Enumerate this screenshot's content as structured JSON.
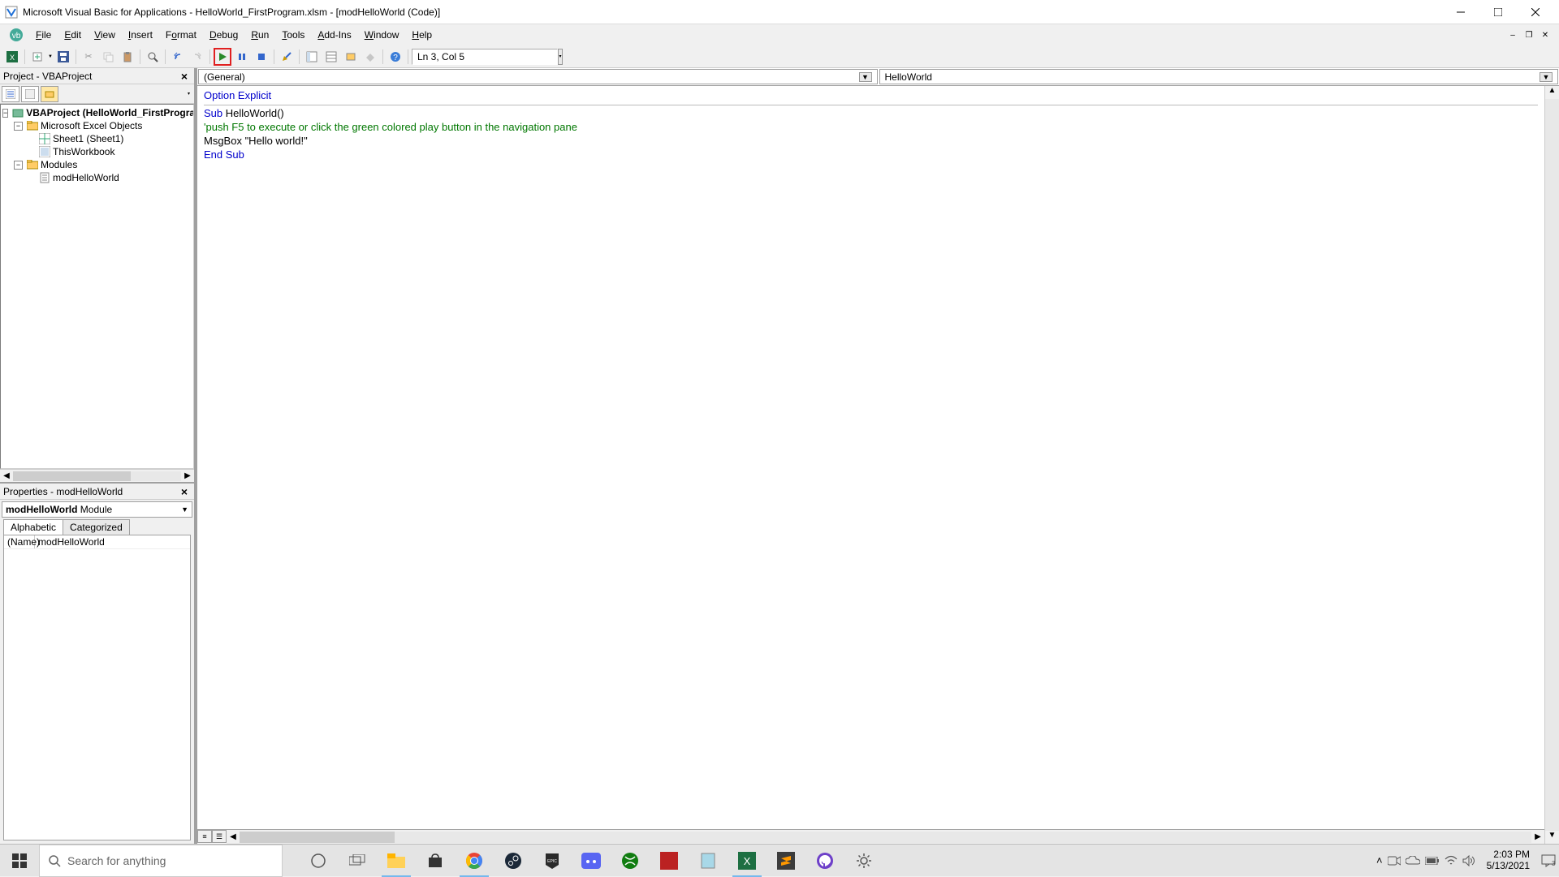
{
  "window": {
    "title": "Microsoft Visual Basic for Applications - HelloWorld_FirstProgram.xlsm - [modHelloWorld (Code)]"
  },
  "menubar": {
    "file": "File",
    "edit": "Edit",
    "view": "View",
    "insert": "Insert",
    "format": "Format",
    "debug": "Debug",
    "run": "Run",
    "tools": "Tools",
    "addins": "Add-Ins",
    "window": "Window",
    "help": "Help"
  },
  "toolbar": {
    "cursor_pos": "Ln 3, Col 5"
  },
  "project_panel": {
    "title": "Project - VBAProject",
    "root": "VBAProject (HelloWorld_FirstProgram.xlsm)",
    "excel_objects": "Microsoft Excel Objects",
    "sheet1": "Sheet1 (Sheet1)",
    "thisworkbook": "ThisWorkbook",
    "modules": "Modules",
    "mod1": "modHelloWorld"
  },
  "properties_panel": {
    "title": "Properties - modHelloWorld",
    "combo_object": "modHelloWorld",
    "combo_type": "Module",
    "tab_alpha": "Alphabetic",
    "tab_cat": "Categorized",
    "prop_name_label": "(Name)",
    "prop_name_value": "modHelloWorld"
  },
  "code_combos": {
    "left": "(General)",
    "right": "HelloWorld"
  },
  "code": {
    "l1_a": "Option",
    "l1_b": " Explicit",
    "l2": "",
    "l3_a": "Sub",
    "l3_b": " HelloWorld()",
    "l4": "",
    "l5": "'push F5 to execute or click the green colored play button in the navigation pane",
    "l6": "",
    "l7": "MsgBox \"Hello world!\"",
    "l8": "",
    "l9_a": "End",
    "l9_b": " Sub"
  },
  "taskbar": {
    "search_placeholder": "Search for anything",
    "time": "2:03 PM",
    "date": "5/13/2021"
  }
}
